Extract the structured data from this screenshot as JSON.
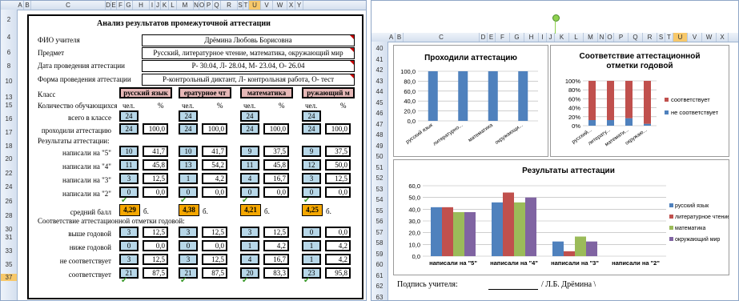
{
  "left": {
    "col_headers": [
      "A",
      "B",
      "C",
      "D",
      "E",
      "F",
      "G",
      "H",
      "I",
      "J",
      "K",
      "L",
      "M",
      "N",
      "O",
      "P",
      "Q",
      "R",
      "S",
      "T",
      "U",
      "V",
      "W",
      "X",
      "Y"
    ],
    "row_headers": [
      "2",
      "4",
      "6",
      "8",
      "10",
      "13",
      "15",
      "16",
      "17",
      "18",
      "20",
      "22",
      "24",
      "26",
      "28",
      "30",
      "31",
      "33",
      "35",
      "37"
    ],
    "title": "Анализ результатов промежуточной аттестации",
    "fields": [
      {
        "label": "ФИО учителя",
        "value": "Дрёмина Любовь Борисовна"
      },
      {
        "label": "Предмет",
        "value": "Русский, литературное чтение, математика, окружающий мир"
      },
      {
        "label": "Дата проведения аттестации",
        "value": "Р- 30.04, Л- 28.04, М- 23.04, О- 26.04"
      },
      {
        "label": "Форма проведения аттестации",
        "value": "Р-контрольный диктант, Л- контрольная работа, О- тест"
      }
    ],
    "class_label": "Класс",
    "subjects": [
      "русский язык",
      "ературное чт",
      "математика",
      "ружающий м"
    ],
    "count_label": "Количество обучающихся",
    "unit_people": "чел.",
    "unit_pct": "%",
    "rows": {
      "total": {
        "label": "всего в классе",
        "values": [
          "24",
          "24",
          "24",
          "24"
        ]
      },
      "passed": {
        "label": "проходили аттестацию",
        "values": [
          [
            "24",
            "100,0"
          ],
          [
            "24",
            "100,0"
          ],
          [
            "24",
            "100,0"
          ],
          [
            "24",
            "100,0"
          ]
        ]
      },
      "results_label": "Результаты аттестации:",
      "g5": {
        "label": "написали на \"5\"",
        "values": [
          [
            "10",
            "41,7"
          ],
          [
            "10",
            "41,7"
          ],
          [
            "9",
            "37,5"
          ],
          [
            "9",
            "37,5"
          ]
        ]
      },
      "g4": {
        "label": "написали на \"4\"",
        "values": [
          [
            "11",
            "45,8"
          ],
          [
            "13",
            "54,2"
          ],
          [
            "11",
            "45,8"
          ],
          [
            "12",
            "50,0"
          ]
        ]
      },
      "g3": {
        "label": "написали на \"3\"",
        "values": [
          [
            "3",
            "12,5"
          ],
          [
            "1",
            "4,2"
          ],
          [
            "4",
            "16,7"
          ],
          [
            "3",
            "12,5"
          ]
        ]
      },
      "g2": {
        "label": "написали на \"2\"",
        "values": [
          [
            "0",
            "0,0"
          ],
          [
            "0",
            "0,0"
          ],
          [
            "0",
            "0,0"
          ],
          [
            "0",
            "0,0"
          ]
        ]
      },
      "avg": {
        "label": "средний балл",
        "values": [
          "4,29",
          "4,38",
          "4,21",
          "4,25"
        ],
        "unit": "б."
      },
      "conf_label": "Соответствие аттестационной отметки годовой:",
      "above": {
        "label": "выше годовой",
        "values": [
          [
            "3",
            "12,5"
          ],
          [
            "3",
            "12,5"
          ],
          [
            "3",
            "12,5"
          ],
          [
            "0",
            "0,0"
          ]
        ]
      },
      "below": {
        "label": "ниже годовой",
        "values": [
          [
            "0",
            "0,0"
          ],
          [
            "0",
            "0,0"
          ],
          [
            "1",
            "4,2"
          ],
          [
            "1",
            "4,2"
          ]
        ]
      },
      "notmatch": {
        "label": "не соответствует",
        "values": [
          [
            "3",
            "12,5"
          ],
          [
            "3",
            "12,5"
          ],
          [
            "4",
            "16,7"
          ],
          [
            "1",
            "4,2"
          ]
        ]
      },
      "match": {
        "label": "соответствует",
        "values": [
          [
            "21",
            "87,5"
          ],
          [
            "21",
            "87,5"
          ],
          [
            "20",
            "83,3"
          ],
          [
            "23",
            "95,8"
          ]
        ]
      }
    }
  },
  "right": {
    "col_headers": [
      "A",
      "B",
      "C",
      "D",
      "E",
      "F",
      "G",
      "H",
      "I",
      "J",
      "K",
      "L",
      "M",
      "N",
      "O",
      "P",
      "Q",
      "R",
      "S",
      "T",
      "U",
      "V",
      "W",
      "X"
    ],
    "row_headers": [
      "40",
      "41",
      "42",
      "43",
      "44",
      "45",
      "46",
      "47",
      "48",
      "49",
      "50",
      "51",
      "52",
      "53",
      "54",
      "55",
      "56",
      "57",
      "58",
      "59",
      "60",
      "61",
      "62",
      "63"
    ],
    "signature_label": "Подпись учителя:",
    "signature_value": "/ Л.Б. Дрёмина \\"
  },
  "chart_data": [
    {
      "type": "bar",
      "title": "Проходили аттестацию",
      "categories": [
        "русский язык",
        "литературно...",
        "математика",
        "окружающи..."
      ],
      "series": [
        {
          "values": [
            100,
            100,
            100,
            100
          ],
          "color": "#4f81bd"
        }
      ],
      "ylim": [
        0,
        100
      ],
      "ticks": [
        "0,0",
        "20,0",
        "40,0",
        "60,0",
        "80,0",
        "100,0"
      ]
    },
    {
      "type": "bar",
      "stacked_percent": true,
      "title": "Соответствие аттестационной отметки годовой",
      "categories": [
        "русский...",
        "литерату...",
        "математи...",
        "окружаю..."
      ],
      "series": [
        {
          "name": "соответствует",
          "values": [
            87.5,
            87.5,
            83.3,
            95.8
          ],
          "color": "#c0504d"
        },
        {
          "name": "не соответствует",
          "values": [
            12.5,
            12.5,
            16.7,
            4.2
          ],
          "color": "#4f81bd"
        }
      ],
      "ticks": [
        "0%",
        "20%",
        "40%",
        "60%",
        "80%",
        "100%"
      ]
    },
    {
      "type": "bar",
      "title": "Результаты аттестации",
      "categories": [
        "написали на \"5\"",
        "написали на \"4\"",
        "написали на \"3\"",
        "написали на \"2\""
      ],
      "series": [
        {
          "name": "русский язык",
          "values": [
            41.7,
            45.8,
            12.5,
            0
          ],
          "color": "#4f81bd"
        },
        {
          "name": "литературное чтение",
          "values": [
            41.7,
            54.2,
            4.2,
            0
          ],
          "color": "#c0504d"
        },
        {
          "name": "математика",
          "values": [
            37.5,
            45.8,
            16.7,
            0
          ],
          "color": "#9bbb59"
        },
        {
          "name": "окружающий мир",
          "values": [
            37.5,
            50.0,
            12.5,
            0
          ],
          "color": "#8064a2"
        }
      ],
      "ylim": [
        0,
        60
      ],
      "ticks": [
        "0,0",
        "10,0",
        "20,0",
        "30,0",
        "40,0",
        "50,0",
        "60,0"
      ]
    }
  ]
}
